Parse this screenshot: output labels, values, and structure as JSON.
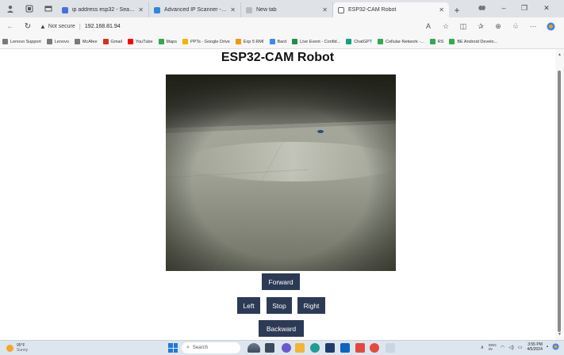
{
  "browser": {
    "tabs": [
      {
        "label": "ip address esp32 - Search",
        "icon": "search-icon",
        "color": "#4a6fd6"
      },
      {
        "label": "Advanced IP Scanner - Downloa",
        "icon": "scanner-icon",
        "color": "#2e86de"
      },
      {
        "label": "New tab",
        "icon": "page-icon",
        "color": "#888888"
      },
      {
        "label": "ESP32-CAM Robot",
        "icon": "page-icon",
        "color": "#666666",
        "active": true
      }
    ],
    "security_label": "Not secure",
    "url": "192.168.81.94",
    "bookmarks": [
      {
        "label": "Lenovo Support",
        "color": "#7a7a7a"
      },
      {
        "label": "Lenovo",
        "color": "#7a7a7a"
      },
      {
        "label": "McAfee",
        "color": "#7a7a7a"
      },
      {
        "label": "Gmail",
        "color": "#d93025"
      },
      {
        "label": "YouTube",
        "color": "#ff0000"
      },
      {
        "label": "Maps",
        "color": "#34a853"
      },
      {
        "label": "PPTs - Google Drive",
        "color": "#f4b400"
      },
      {
        "label": "Exp 5 RMI",
        "color": "#f29900"
      },
      {
        "label": "Bard",
        "color": "#4285f4"
      },
      {
        "label": "Live Event - Confid...",
        "color": "#2a8a4b"
      },
      {
        "label": "ChatGPT",
        "color": "#10a37f"
      },
      {
        "label": "Cellular-Network -...",
        "color": "#34a853"
      },
      {
        "label": "RS",
        "color": "#34a853"
      },
      {
        "label": "BE Android Develo...",
        "color": "#34a853"
      }
    ]
  },
  "page": {
    "title": "ESP32-CAM Robot",
    "controls": {
      "forward": "Forward",
      "left": "Left",
      "stop": "Stop",
      "right": "Right",
      "backward": "Backward"
    }
  },
  "taskbar": {
    "weather": {
      "temp": "95°F",
      "cond": "Sunny"
    },
    "search_placeholder": "Search",
    "tray": {
      "lang": "ENG",
      "lang2": "IN",
      "time": "3:55 PM",
      "date": "4/5/2024"
    }
  },
  "colors": {
    "button_bg": "#2c3a55",
    "tabbar_bg": "#dfe3e8",
    "taskbar_bg": "#dde5ee"
  }
}
